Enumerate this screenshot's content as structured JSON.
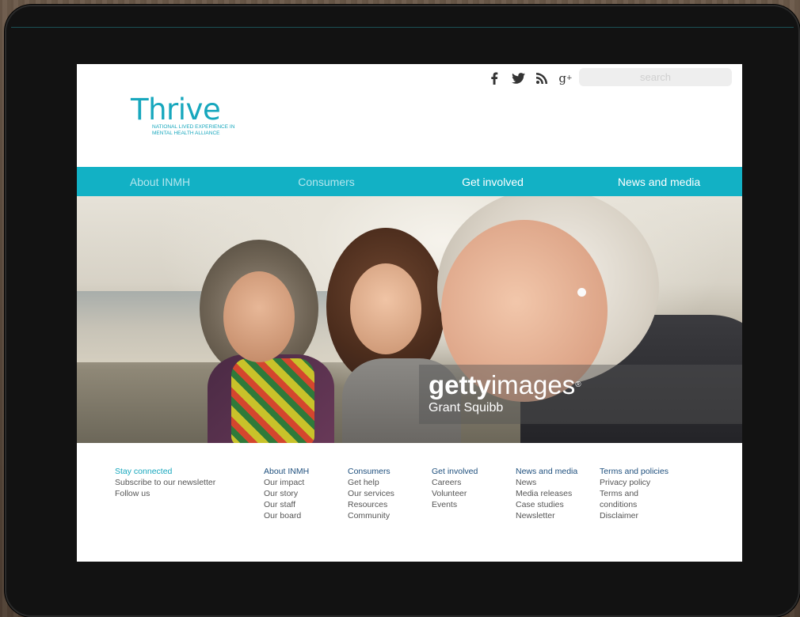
{
  "social": {
    "facebook_glyph": "f",
    "twitter_glyph": "🐦",
    "rss_glyph": "\\",
    "gplus_glyph": "g+"
  },
  "search": {
    "placeholder": "search"
  },
  "logo": {
    "name": "Thrive",
    "tagline_line1": "NATIONAL LIVED EXPERIENCE IN",
    "tagline_line2": "MENTAL HEALTH ALLIANCE",
    "color": "#17a7bd"
  },
  "nav": {
    "items": [
      {
        "label": "About INMH"
      },
      {
        "label": "Consumers"
      },
      {
        "label": "Get involved"
      },
      {
        "label": "News and media"
      }
    ],
    "background": "#12b1c5"
  },
  "hero": {
    "watermark_brand_bold": "getty",
    "watermark_brand_rest": "images",
    "watermark_reg": "®",
    "credit": "Grant Squibb"
  },
  "footer": {
    "stay": {
      "heading": "Stay connected",
      "links": [
        "Subscribe to our newsletter",
        "Follow us"
      ]
    },
    "columns": [
      {
        "heading": "About INMH",
        "links": [
          "Our impact",
          "Our story",
          "Our staff",
          "Our board"
        ]
      },
      {
        "heading": "Consumers",
        "links": [
          "Get help",
          "Our services",
          "Resources",
          "Community"
        ]
      },
      {
        "heading": "Get involved",
        "links": [
          "Careers",
          "Volunteer",
          "Events"
        ]
      },
      {
        "heading": "News and media",
        "links": [
          "News",
          "Media releases",
          "Case studies",
          "Newsletter"
        ]
      },
      {
        "heading": "Terms and policies",
        "links": [
          "Privacy policy",
          "Terms and",
          "conditions",
          "Disclaimer"
        ]
      }
    ]
  }
}
